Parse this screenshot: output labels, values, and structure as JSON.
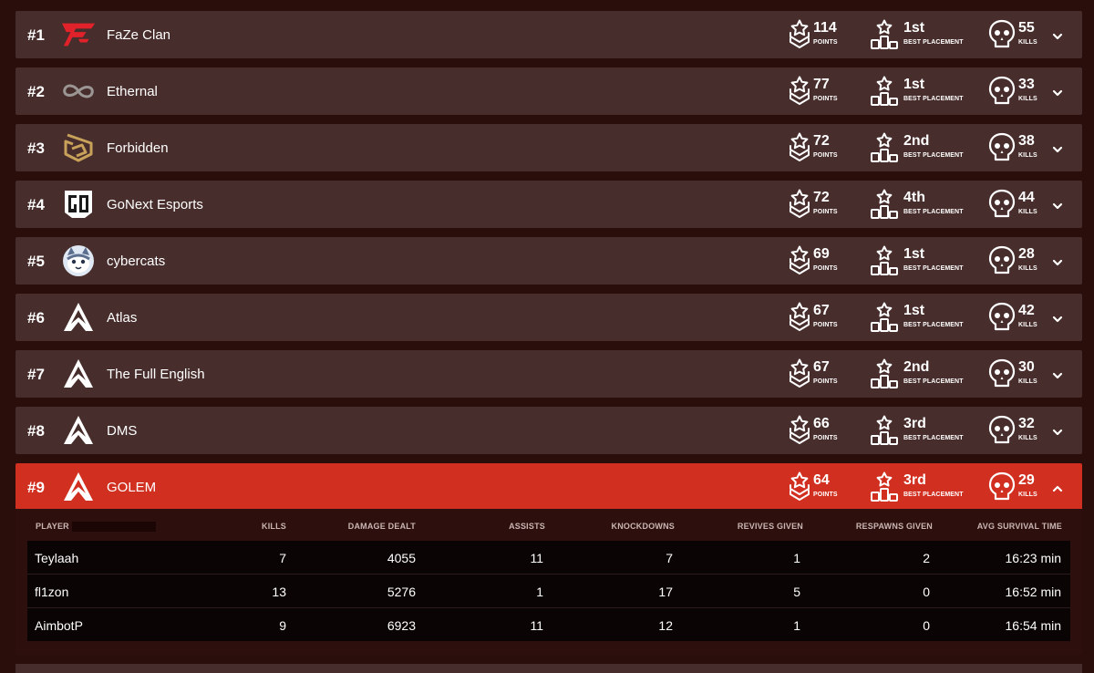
{
  "labels": {
    "points": "POINTS",
    "best_placement": "BEST PLACEMENT",
    "kills": "KILLS"
  },
  "teams": [
    {
      "rank": "#1",
      "name": "FaZe Clan",
      "logo": "faze-logo",
      "points": "114",
      "best": "1st",
      "kills": "55",
      "expanded": false
    },
    {
      "rank": "#2",
      "name": "Ethernal",
      "logo": "infinity-logo",
      "points": "77",
      "best": "1st",
      "kills": "33",
      "expanded": false
    },
    {
      "rank": "#3",
      "name": "Forbidden",
      "logo": "forbidden-logo",
      "points": "72",
      "best": "2nd",
      "kills": "38",
      "expanded": false
    },
    {
      "rank": "#4",
      "name": "GoNext Esports",
      "logo": "gonext-logo",
      "points": "72",
      "best": "4th",
      "kills": "44",
      "expanded": false
    },
    {
      "rank": "#5",
      "name": "cybercats",
      "logo": "cybercats-logo",
      "points": "69",
      "best": "1st",
      "kills": "28",
      "expanded": false
    },
    {
      "rank": "#6",
      "name": "Atlas",
      "logo": "apex-logo",
      "points": "67",
      "best": "1st",
      "kills": "42",
      "expanded": false
    },
    {
      "rank": "#7",
      "name": "The Full English",
      "logo": "apex-logo",
      "points": "67",
      "best": "2nd",
      "kills": "30",
      "expanded": false
    },
    {
      "rank": "#8",
      "name": "DMS",
      "logo": "apex-logo",
      "points": "66",
      "best": "3rd",
      "kills": "32",
      "expanded": false
    },
    {
      "rank": "#9",
      "name": "GOLEM",
      "logo": "apex-logo",
      "points": "64",
      "best": "3rd",
      "kills": "29",
      "expanded": true
    }
  ],
  "details": {
    "headers": {
      "player": "PLAYER",
      "kills": "KILLS",
      "damage": "DAMAGE DEALT",
      "assists": "ASSISTS",
      "knockdowns": "KNOCKDOWNS",
      "revives": "REVIVES GIVEN",
      "respawns": "RESPAWNS GIVEN",
      "survival": "AVG SURVIVAL TIME"
    },
    "players": [
      {
        "name": "Teylaah",
        "kills": "7",
        "damage": "4055",
        "assists": "11",
        "knockdowns": "7",
        "revives": "1",
        "respawns": "2",
        "survival": "16:23 min"
      },
      {
        "name": "fl1zon",
        "kills": "13",
        "damage": "5276",
        "assists": "1",
        "knockdowns": "17",
        "revives": "5",
        "respawns": "0",
        "survival": "16:52 min"
      },
      {
        "name": "AimbotP",
        "kills": "9",
        "damage": "6923",
        "assists": "11",
        "knockdowns": "12",
        "revives": "1",
        "respawns": "0",
        "survival": "16:54 min"
      }
    ]
  },
  "colors": {
    "background": "#2a0e0c",
    "row": "#472d2b",
    "highlight": "#d12f20",
    "table": "#0b0404",
    "faze_red": "#e2222a",
    "forbidden_gold": "#c8a25a"
  }
}
